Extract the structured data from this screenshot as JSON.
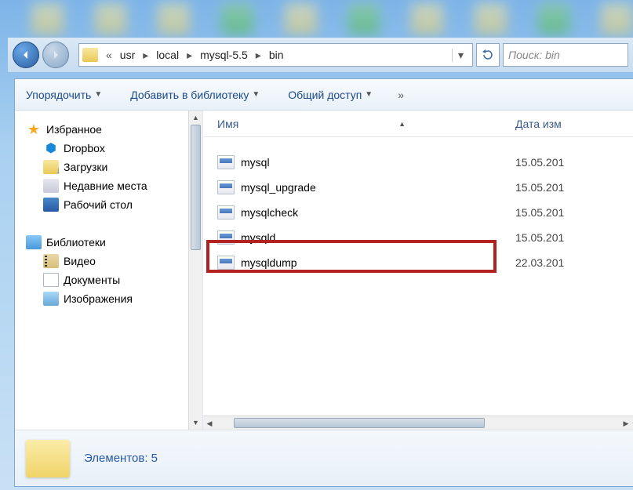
{
  "breadcrumb": {
    "items": [
      "usr",
      "local",
      "mysql-5.5",
      "bin"
    ],
    "overflow": "«"
  },
  "search": {
    "placeholder": "Поиск: bin"
  },
  "toolbar": {
    "organize": "Упорядочить",
    "add_library": "Добавить в библиотеку",
    "share": "Общий доступ",
    "more": "»"
  },
  "nav": {
    "favorites": {
      "label": "Избранное",
      "items": [
        {
          "label": "Dropbox",
          "icon": "dropbox"
        },
        {
          "label": "Загрузки",
          "icon": "downloads"
        },
        {
          "label": "Недавние места",
          "icon": "recent"
        },
        {
          "label": "Рабочий стол",
          "icon": "desktop"
        }
      ]
    },
    "libraries": {
      "label": "Библиотеки",
      "items": [
        {
          "label": "Видео",
          "icon": "video"
        },
        {
          "label": "Документы",
          "icon": "doc"
        },
        {
          "label": "Изображения",
          "icon": "img"
        }
      ]
    }
  },
  "columns": {
    "name": "Имя",
    "date": "Дата изм"
  },
  "files": [
    {
      "name": "mysql",
      "date": "15.05.201"
    },
    {
      "name": "mysql_upgrade",
      "date": "15.05.201"
    },
    {
      "name": "mysqlcheck",
      "date": "15.05.201"
    },
    {
      "name": "mysqld",
      "date": "15.05.201"
    },
    {
      "name": "mysqldump",
      "date": "22.03.201"
    }
  ],
  "status": {
    "count_label": "Элементов: 5"
  },
  "highlight": {
    "target": "mysqldump"
  }
}
